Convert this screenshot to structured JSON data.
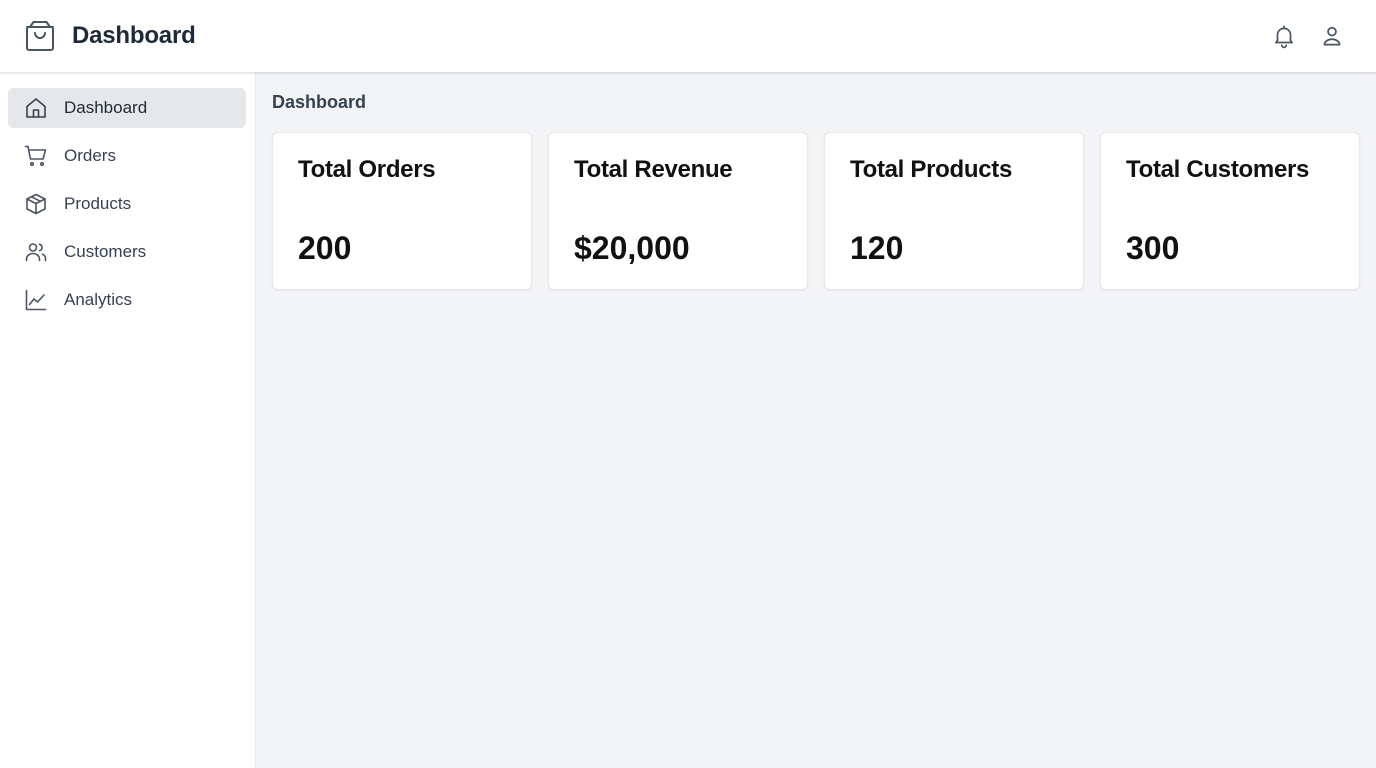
{
  "header": {
    "title": "Dashboard",
    "brand_icon": "shopping-bag-icon",
    "notification_icon": "bell-icon",
    "profile_icon": "user-icon"
  },
  "sidebar": {
    "items": [
      {
        "label": "Dashboard",
        "icon": "home-icon",
        "active": true
      },
      {
        "label": "Orders",
        "icon": "cart-icon",
        "active": false
      },
      {
        "label": "Products",
        "icon": "box-icon",
        "active": false
      },
      {
        "label": "Customers",
        "icon": "users-icon",
        "active": false
      },
      {
        "label": "Analytics",
        "icon": "chart-line-icon",
        "active": false
      }
    ]
  },
  "main": {
    "page_title": "Dashboard",
    "cards": [
      {
        "title": "Total Orders",
        "value": "200"
      },
      {
        "title": "Total Revenue",
        "value": "$20,000"
      },
      {
        "title": "Total Products",
        "value": "120"
      },
      {
        "title": "Total Customers",
        "value": "300"
      }
    ]
  },
  "colors": {
    "main_background": "#f3f4f6",
    "active_nav_background": "#e5e7eb",
    "card_background": "#ffffff",
    "text_primary": "#111111",
    "icon_color": "#4b5563"
  }
}
